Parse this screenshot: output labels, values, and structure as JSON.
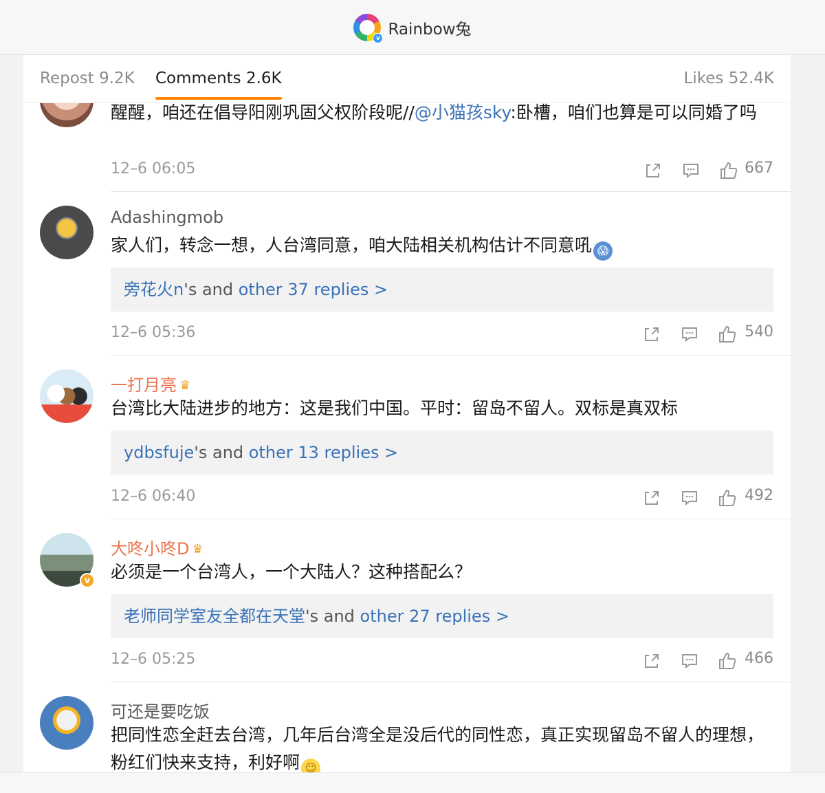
{
  "header": {
    "title": "Rainbow兔",
    "verified_icon": "v-badge-icon"
  },
  "tabs": {
    "repost": "Repost 9.2K",
    "comments": "Comments 2.6K",
    "likes": "Likes 52.4K"
  },
  "comments": [
    {
      "text_pre": "醒醒，咱还在倡导阳刚巩固父权阶段呢//",
      "mention": "@小猫孩sky",
      "text_post": ":卧槽，咱们也算是可以同婚了吗",
      "time": "12–6 06:05",
      "likes": "667"
    },
    {
      "user": "Adashingmob",
      "text": "家人们，转念一想，人台湾同意，咱大陆相关机构估计不同意吼",
      "emoji": "shocked-face-emoji",
      "replies_user": "旁花火n",
      "replies_mid": "'s and ",
      "replies_more": "other 37 replies >",
      "time": "12–6 05:36",
      "likes": "540"
    },
    {
      "user": "一打月亮",
      "text": "台湾比大陆进步的地方：这是我们中国。平时：留岛不留人。双标是真双标",
      "replies_user": "ydbsfuje",
      "replies_mid": "'s and ",
      "replies_more": "other 13 replies >",
      "time": "12–6 06:40",
      "likes": "492"
    },
    {
      "user": "大咚小咚D",
      "text": "必须是一个台湾人，一个大陆人？这种搭配么？",
      "replies_user": "老师同学室友全都在天堂",
      "replies_mid": "'s and ",
      "replies_more": "other 27 replies >",
      "time": "12–6 05:25",
      "likes": "466"
    },
    {
      "user": "可还是要吃饭",
      "text": "把同性恋全赶去台湾，几年后台湾全是没后代的同性恋，真正实现留岛不留人的理想，粉红们快来支持，利好啊",
      "emoji": "smile-face-emoji"
    }
  ],
  "colors": {
    "accent": "#ff8200",
    "link": "#3a72b8",
    "vip_name": "#eb7350"
  }
}
